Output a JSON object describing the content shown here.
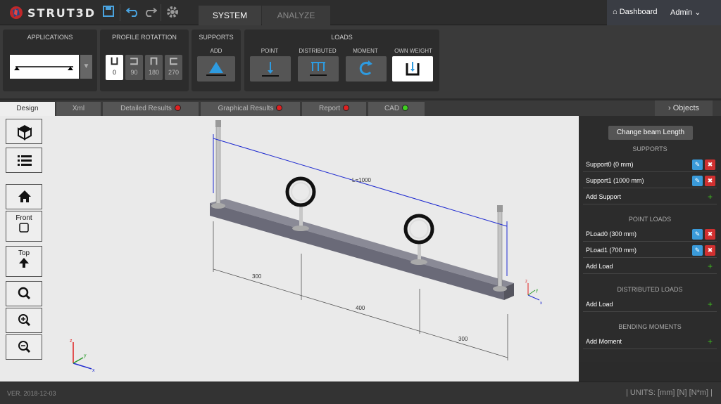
{
  "app": {
    "logo_text": "STRUT3D",
    "tabs": [
      "SYSTEM",
      "ANALYZE"
    ],
    "dashboard_label": "Dashboard",
    "admin_label": "Admin"
  },
  "ribbon": {
    "applications_title": "APPLICATIONS",
    "profile_rotation_title": "PROFILE ROTATTION",
    "rotations": [
      "0",
      "90",
      "180",
      "270"
    ],
    "rotation_selected": "0",
    "supports_title": "SUPPORTS",
    "supports_add_label": "ADD",
    "loads_title": "LOADS",
    "loads": [
      "POINT",
      "DISTRIBUTED",
      "MOMENT",
      "OWN WEIGHT"
    ]
  },
  "subtabs": {
    "design": "Design",
    "xml": "Xml",
    "detailed": "Detailed Results",
    "graphical": "Graphical Results",
    "report": "Report",
    "cad": "CAD",
    "objects": "Objects"
  },
  "side_toolbar": {
    "front_label": "Front",
    "top_label": "Top"
  },
  "scene": {
    "length_label": "L=1000",
    "dim_1": "300",
    "dim_2": "400",
    "dim_3": "300",
    "axis_x": "x",
    "axis_y": "y",
    "axis_z": "z"
  },
  "objects": {
    "change_beam_label": "Change beam Length",
    "supports_title": "SUPPORTS",
    "supports": [
      "Support0 (0 mm)",
      "Support1 (1000 mm)"
    ],
    "add_support": "Add Support",
    "point_loads_title": "POINT LOADS",
    "point_loads": [
      "PLoad0 (300 mm)",
      "PLoad1 (700 mm)"
    ],
    "add_load": "Add Load",
    "distributed_title": "DISTRIBUTED LOADS",
    "add_dist_load": "Add Load",
    "bending_title": "BENDING MOMENTS",
    "add_moment": "Add Moment"
  },
  "footer": {
    "version": "VER. 2018-12-03",
    "units": "| UNITS: [mm] [N] [N*m] |"
  },
  "colors": {
    "accent_blue": "#3a9ad9",
    "delete_red": "#d03030",
    "status_red": "#e02020",
    "status_green": "#3fd020",
    "dimension_blue": "#1e2ad0"
  }
}
